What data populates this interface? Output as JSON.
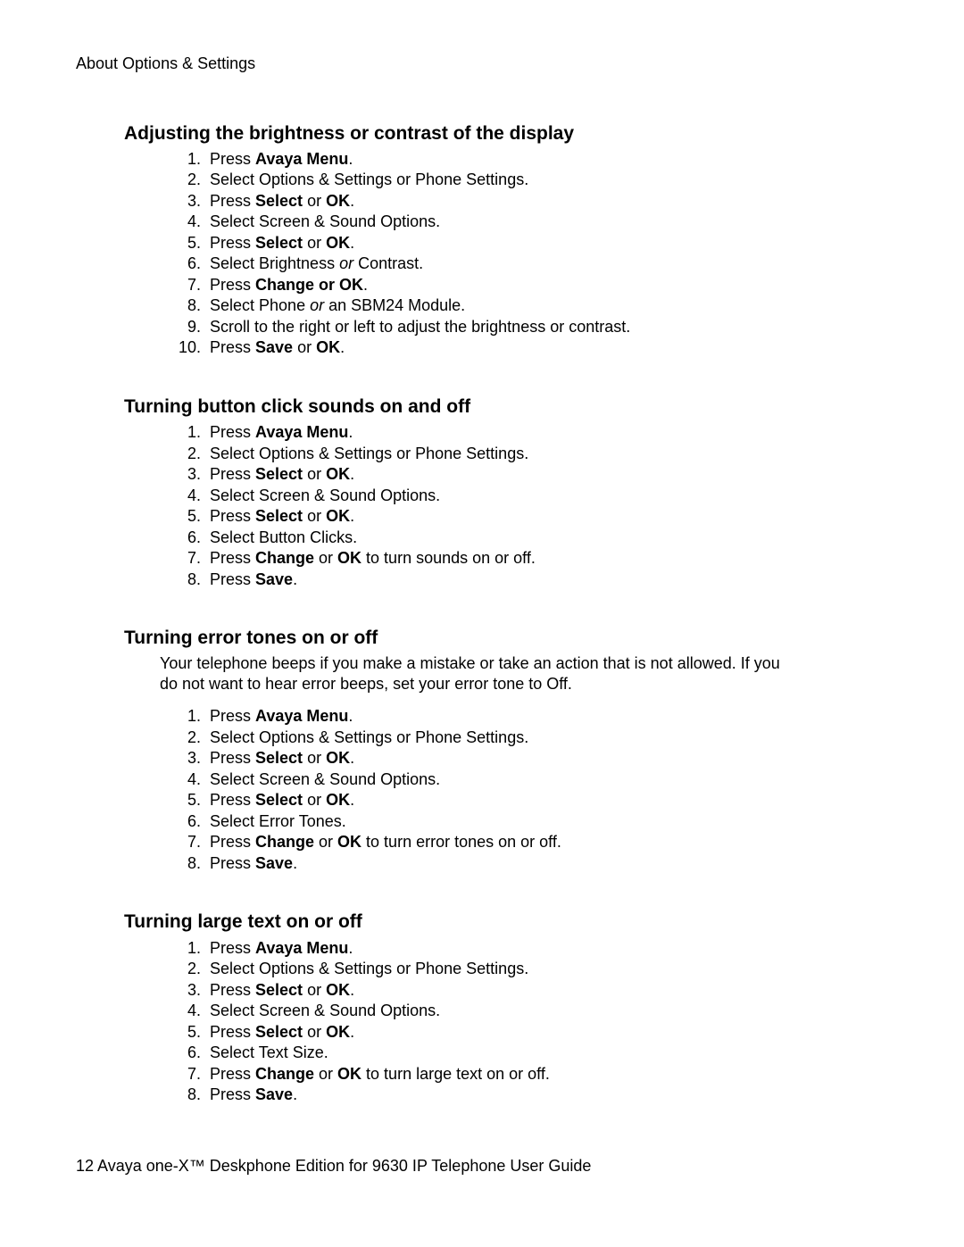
{
  "header": "About Options & Settings",
  "footer": {
    "page": "12",
    "sep": "   ",
    "title": "Avaya one-X™ Deskphone Edition  for 9630 IP Telephone User Guide"
  },
  "sections": [
    {
      "heading": "Adjusting the brightness or contrast of the display",
      "intro": "",
      "steps": [
        [
          {
            "t": "Press "
          },
          {
            "t": "Avaya Menu",
            "b": true
          },
          {
            "t": "."
          }
        ],
        [
          {
            "t": "Select Options & Settings or Phone Settings."
          }
        ],
        [
          {
            "t": "Press "
          },
          {
            "t": "Select",
            "b": true
          },
          {
            "t": " or "
          },
          {
            "t": "OK",
            "b": true
          },
          {
            "t": "."
          }
        ],
        [
          {
            "t": "Select Screen & Sound Options."
          }
        ],
        [
          {
            "t": "Press "
          },
          {
            "t": "Select",
            "b": true
          },
          {
            "t": " or "
          },
          {
            "t": "OK",
            "b": true
          },
          {
            "t": "."
          }
        ],
        [
          {
            "t": "Select Brightness "
          },
          {
            "t": "or",
            "i": true
          },
          {
            "t": " Contrast."
          }
        ],
        [
          {
            "t": "Press  "
          },
          {
            "t": "Change or OK",
            "b": true
          },
          {
            "t": "."
          }
        ],
        [
          {
            "t": "Select Phone "
          },
          {
            "t": "or",
            "i": true
          },
          {
            "t": " an SBM24 Module."
          }
        ],
        [
          {
            "t": "Scroll to the right or left to adjust the brightness or contrast."
          }
        ],
        [
          {
            "t": "Press "
          },
          {
            "t": "Save",
            "b": true
          },
          {
            "t": " or "
          },
          {
            "t": "OK",
            "b": true
          },
          {
            "t": "."
          }
        ]
      ]
    },
    {
      "heading": "Turning button click sounds on and off",
      "intro": "",
      "steps": [
        [
          {
            "t": "Press "
          },
          {
            "t": "Avaya Menu",
            "b": true
          },
          {
            "t": "."
          }
        ],
        [
          {
            "t": "Select Options & Settings or Phone Settings."
          }
        ],
        [
          {
            "t": "Press "
          },
          {
            "t": "Select",
            "b": true
          },
          {
            "t": " or "
          },
          {
            "t": "OK",
            "b": true
          },
          {
            "t": "."
          }
        ],
        [
          {
            "t": "Select Screen & Sound Options."
          }
        ],
        [
          {
            "t": "Press "
          },
          {
            "t": "Select",
            "b": true
          },
          {
            "t": " or "
          },
          {
            "t": "OK",
            "b": true
          },
          {
            "t": "."
          }
        ],
        [
          {
            "t": "Select Button Clicks."
          }
        ],
        [
          {
            "t": "Press "
          },
          {
            "t": "Change",
            "b": true
          },
          {
            "t": " or "
          },
          {
            "t": "OK",
            "b": true
          },
          {
            "t": " to turn sounds on or off."
          }
        ],
        [
          {
            "t": "Press "
          },
          {
            "t": "Save",
            "b": true
          },
          {
            "t": "."
          }
        ]
      ]
    },
    {
      "heading": "Turning error tones on or off",
      "intro": "Your telephone beeps if you make a mistake or take an action that is not allowed. If you do not want to hear error beeps, set your error tone to Off.",
      "steps": [
        [
          {
            "t": "Press "
          },
          {
            "t": "Avaya Menu",
            "b": true
          },
          {
            "t": "."
          }
        ],
        [
          {
            "t": "Select Options & Settings or Phone Settings."
          }
        ],
        [
          {
            "t": "Press "
          },
          {
            "t": "Select",
            "b": true
          },
          {
            "t": " or "
          },
          {
            "t": "OK",
            "b": true
          },
          {
            "t": "."
          }
        ],
        [
          {
            "t": "Select Screen & Sound Options."
          }
        ],
        [
          {
            "t": "Press "
          },
          {
            "t": "Select",
            "b": true
          },
          {
            "t": " or "
          },
          {
            "t": "OK",
            "b": true
          },
          {
            "t": "."
          }
        ],
        [
          {
            "t": "Select Error Tones."
          }
        ],
        [
          {
            "t": "Press "
          },
          {
            "t": "Change",
            "b": true
          },
          {
            "t": " or "
          },
          {
            "t": "OK",
            "b": true
          },
          {
            "t": " to turn error tones on or off."
          }
        ],
        [
          {
            "t": "Press "
          },
          {
            "t": "Save",
            "b": true
          },
          {
            "t": "."
          }
        ]
      ]
    },
    {
      "heading": "Turning large text on or off",
      "intro": "",
      "steps": [
        [
          {
            "t": "Press "
          },
          {
            "t": "Avaya Menu",
            "b": true
          },
          {
            "t": "."
          }
        ],
        [
          {
            "t": "Select Options & Settings or Phone Settings."
          }
        ],
        [
          {
            "t": "Press "
          },
          {
            "t": "Select",
            "b": true
          },
          {
            "t": " or "
          },
          {
            "t": "OK",
            "b": true
          },
          {
            "t": "."
          }
        ],
        [
          {
            "t": "Select Screen & Sound Options."
          }
        ],
        [
          {
            "t": "Press "
          },
          {
            "t": "Select",
            "b": true
          },
          {
            "t": " or "
          },
          {
            "t": "OK",
            "b": true
          },
          {
            "t": "."
          }
        ],
        [
          {
            "t": "Select Text Size."
          }
        ],
        [
          {
            "t": "Press "
          },
          {
            "t": "Change",
            "b": true
          },
          {
            "t": " or "
          },
          {
            "t": "OK",
            "b": true
          },
          {
            "t": " to turn large text on or off."
          }
        ],
        [
          {
            "t": "Press "
          },
          {
            "t": "Save",
            "b": true
          },
          {
            "t": "."
          }
        ]
      ]
    }
  ]
}
